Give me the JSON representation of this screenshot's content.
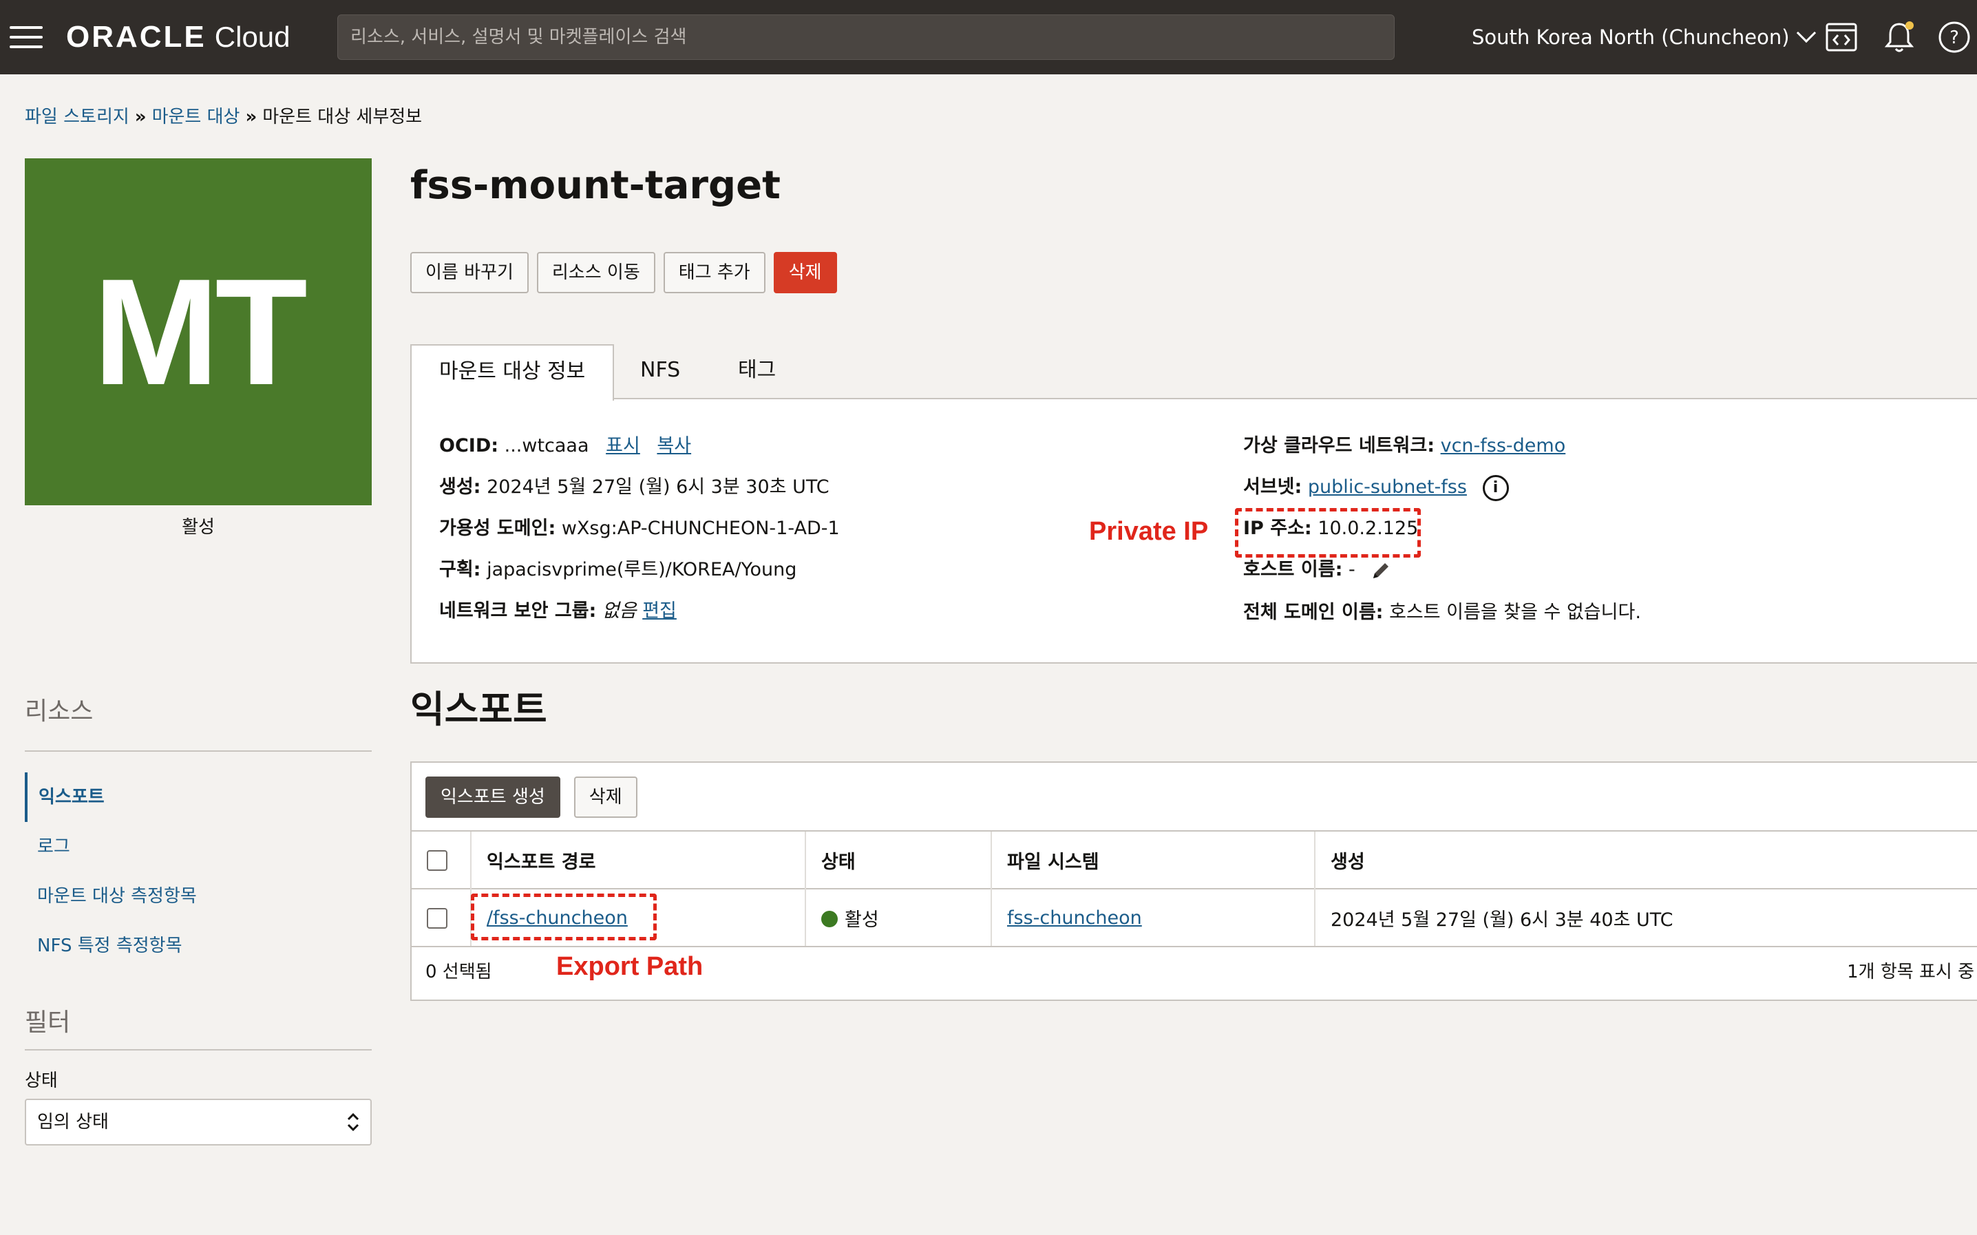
{
  "topbar": {
    "logo_oracle": "ORACLE",
    "logo_cloud": "Cloud",
    "search_placeholder": "리소스, 서비스, 설명서 및 마켓플레이스 검색",
    "region": "South Korea North (Chuncheon)"
  },
  "breadcrumb": {
    "items": [
      "파일 스토리지",
      "마운트 대상",
      "마운트 대상 세부정보"
    ],
    "separator": "»"
  },
  "tile": {
    "initials": "MT",
    "status": "활성",
    "color": "#4a7a2a"
  },
  "sidebar": {
    "resources_heading": "리소스",
    "items": [
      {
        "label": "익스포트",
        "active": true
      },
      {
        "label": "로그"
      },
      {
        "label": "마운트 대상 측정항목"
      },
      {
        "label": "NFS 특정 측정항목"
      }
    ],
    "filter_heading": "필터",
    "state_label": "상태",
    "state_value": "임의 상태"
  },
  "page": {
    "title": "fss-mount-target",
    "actions": {
      "rename": "이름 바꾸기",
      "move": "리소스 이동",
      "add_tags": "태그 추가",
      "delete": "삭제"
    },
    "tabs": [
      "마운트 대상 정보",
      "NFS",
      "태그"
    ]
  },
  "info": {
    "ocid_label": "OCID:",
    "ocid_value": "...wtcaaa",
    "ocid_show": "표시",
    "ocid_copy": "복사",
    "created_label": "생성:",
    "created_value": "2024년 5월 27일 (월) 6시 3분 30초 UTC",
    "ad_label": "가용성 도메인:",
    "ad_value": "wXsg:AP-CHUNCHEON-1-AD-1",
    "compartment_label": "구획:",
    "compartment_value": "japacisvprime(루트)/KOREA/Young",
    "nsg_label": "네트워크 보안 그룹:",
    "nsg_value": "없음",
    "nsg_edit": "편집",
    "vcn_label": "가상 클라우드 네트워크:",
    "vcn_value": "vcn-fss-demo",
    "subnet_label": "서브넷:",
    "subnet_value": "public-subnet-fss",
    "ip_label": "IP 주소:",
    "ip_value": "10.0.2.125",
    "hostname_label": "호스트 이름:",
    "hostname_value": "-",
    "fqdn_label": "전체 도메인 이름:",
    "fqdn_value": "호스트 이름을 찾을 수 없습니다."
  },
  "annotations": {
    "private_ip": "Private IP",
    "export_path": "Export Path",
    "color": "#e0261b"
  },
  "exports": {
    "title": "익스포트",
    "create_button": "익스포트 생성",
    "delete_button": "삭제",
    "columns": [
      "익스포트 경로",
      "상태",
      "파일 시스템",
      "생성"
    ],
    "rows": [
      {
        "path": "/fss-chuncheon",
        "status": "활성",
        "file_system": "fss-chuncheon",
        "created": "2024년 5월 27일 (월) 6시 3분 40초 UTC"
      }
    ],
    "selected": "0 선택됨",
    "showing": "1개 항목 표시 중"
  }
}
